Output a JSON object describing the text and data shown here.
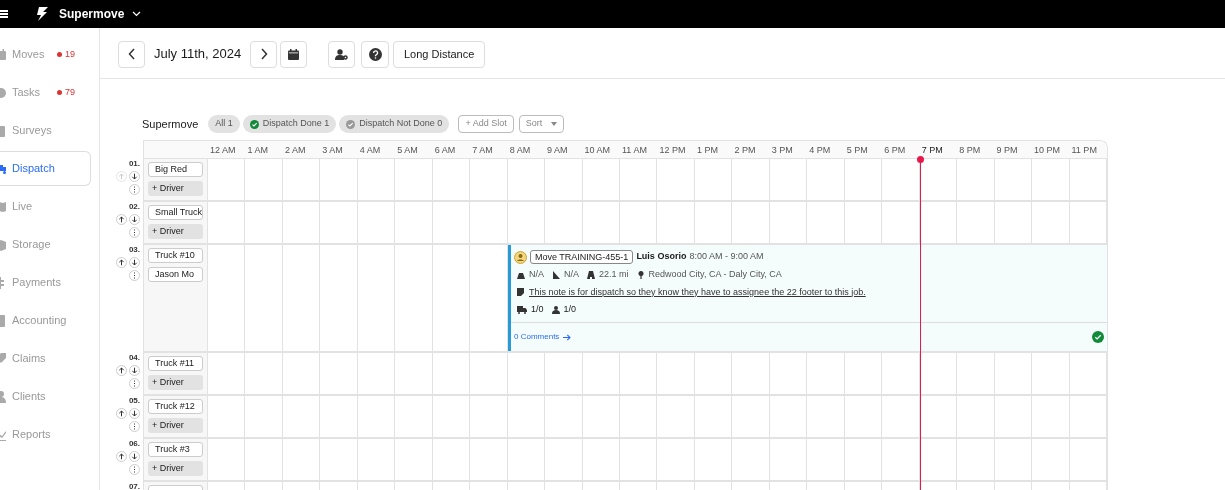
{
  "app": {
    "name": "Supermove"
  },
  "sidebar": {
    "items": [
      {
        "label": "Moves",
        "badge": "19",
        "selected": false
      },
      {
        "label": "Tasks",
        "badge": "79",
        "selected": false
      },
      {
        "label": "Surveys",
        "selected": false
      },
      {
        "label": "Dispatch",
        "selected": true
      },
      {
        "label": "Live",
        "selected": false
      },
      {
        "label": "Storage",
        "selected": false
      },
      {
        "label": "Payments",
        "selected": false
      },
      {
        "label": "Accounting",
        "selected": false
      },
      {
        "label": "Claims",
        "selected": false
      },
      {
        "label": "Clients",
        "selected": false
      },
      {
        "label": "Reports",
        "selected": false
      }
    ]
  },
  "toolbar": {
    "date": "July 11th, 2024",
    "mode_button": "Long Distance"
  },
  "filters": {
    "organization": "Supermove",
    "chips": [
      {
        "kind": "plain",
        "label": "All 1",
        "selected": false
      },
      {
        "kind": "done",
        "label": "Dispatch Done 1",
        "selected": false
      },
      {
        "kind": "not_done",
        "label": "Dispatch Not Done 0",
        "selected": false
      }
    ],
    "add_slot": "+ Add Slot",
    "sort": "Sort"
  },
  "hours": [
    {
      "label": "12 AM",
      "current": false
    },
    {
      "label": "1 AM",
      "current": false
    },
    {
      "label": "2 AM",
      "current": false
    },
    {
      "label": "3 AM",
      "current": false
    },
    {
      "label": "4 AM",
      "current": false
    },
    {
      "label": "5 AM",
      "current": false
    },
    {
      "label": "6 AM",
      "current": false
    },
    {
      "label": "7 AM",
      "current": false
    },
    {
      "label": "8 AM",
      "current": false
    },
    {
      "label": "9 AM",
      "current": false
    },
    {
      "label": "10 AM",
      "current": false
    },
    {
      "label": "11 AM",
      "current": false
    },
    {
      "label": "12 PM",
      "current": false
    },
    {
      "label": "1 PM",
      "current": false
    },
    {
      "label": "2 PM",
      "current": false
    },
    {
      "label": "3 PM",
      "current": false
    },
    {
      "label": "4 PM",
      "current": false
    },
    {
      "label": "5 PM",
      "current": false
    },
    {
      "label": "6 PM",
      "current": false
    },
    {
      "label": "7 PM",
      "current": true
    },
    {
      "label": "8 PM",
      "current": false
    },
    {
      "label": "9 PM",
      "current": false
    },
    {
      "label": "10 PM",
      "current": false
    },
    {
      "label": "11 PM",
      "current": false
    }
  ],
  "slots": [
    {
      "number": "01.",
      "truck": "Big Red",
      "driver_button": "+ Driver",
      "can_move_up": false
    },
    {
      "number": "02.",
      "truck": "Small Truck",
      "driver_button": "+ Driver",
      "can_move_up": true
    },
    {
      "number": "03.",
      "truck": "Truck #10",
      "driver": "Jason Mo",
      "can_move_up": true,
      "job": {
        "tag": "Move TRAINING-455-1",
        "customer": "Luis Osorio",
        "time": "8:00 AM - 9:00 AM",
        "size": "N/A",
        "floor": "N/A",
        "distance": "22.1 mi",
        "route": "Redwood City, CA - Daly City, CA",
        "note": "This note is for dispatch so they know they have to assignee the 22 footer to this job.",
        "trucks": "1/0",
        "crew": "1/0",
        "comments": "0 Comments",
        "dispatch_done": true
      }
    },
    {
      "number": "04.",
      "truck": "Truck #11",
      "driver_button": "+ Driver",
      "can_move_up": true
    },
    {
      "number": "05.",
      "truck": "Truck #12",
      "driver_button": "+ Driver",
      "can_move_up": true
    },
    {
      "number": "06.",
      "truck": "Truck #3",
      "driver_button": "+ Driver",
      "can_move_up": true
    },
    {
      "number": "07."
    }
  ]
}
